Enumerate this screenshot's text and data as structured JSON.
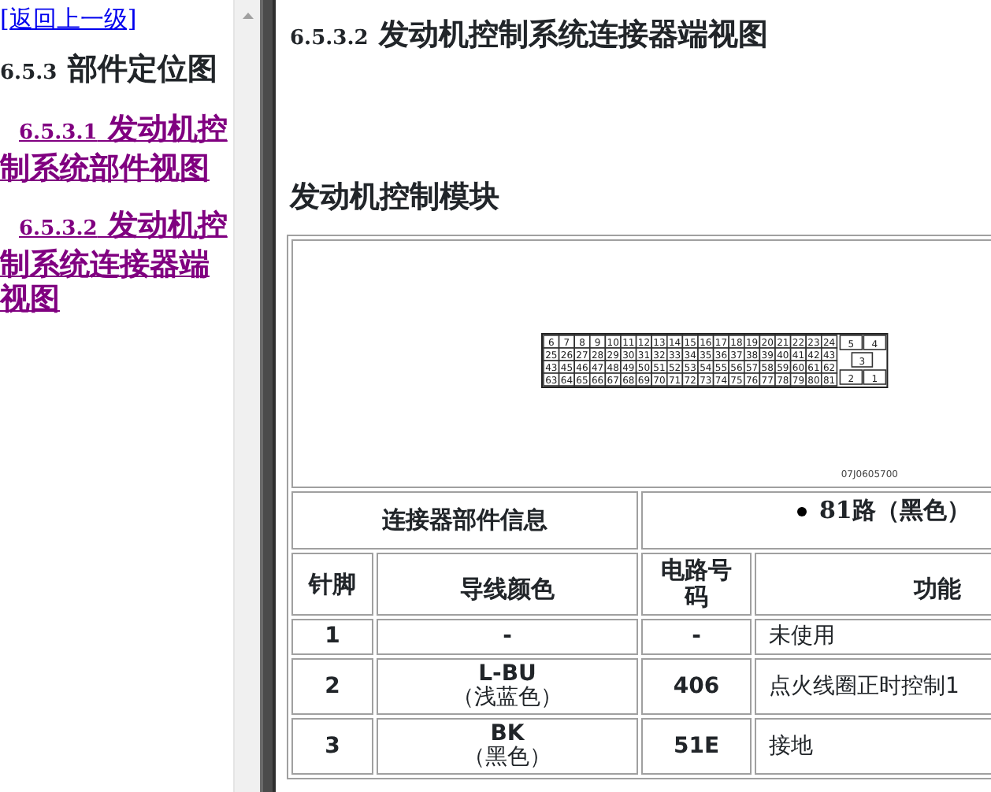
{
  "back_link": "[返回上一级]",
  "section_title": {
    "number": "6.5.3",
    "text": "部件定位图"
  },
  "nav_links": [
    {
      "number": "6.5.3.1",
      "text": "发动机控制系统部件视图"
    },
    {
      "number": "6.5.3.2",
      "text": "发动机控制系统连接器端视图"
    }
  ],
  "page_title": {
    "number": "6.5.3.2",
    "text": "发动机控制系统连接器端视图"
  },
  "subtitle": "发动机控制模块",
  "connector_diagram": {
    "pin_rows": [
      [
        "6",
        "7",
        "8",
        "9",
        "10",
        "11",
        "12",
        "13",
        "14",
        "15",
        "16",
        "17",
        "18",
        "19",
        "20",
        "21",
        "22",
        "23",
        "24"
      ],
      [
        "25",
        "26",
        "27",
        "28",
        "29",
        "30",
        "31",
        "32",
        "33",
        "34",
        "35",
        "36",
        "37",
        "38",
        "39",
        "40",
        "41",
        "42",
        "43"
      ],
      [
        "43",
        "45",
        "46",
        "47",
        "48",
        "49",
        "50",
        "51",
        "52",
        "53",
        "54",
        "55",
        "56",
        "57",
        "58",
        "59",
        "60",
        "61",
        "62"
      ],
      [
        "63",
        "64",
        "65",
        "66",
        "67",
        "68",
        "69",
        "70",
        "71",
        "72",
        "73",
        "74",
        "75",
        "76",
        "77",
        "78",
        "79",
        "80",
        "81"
      ]
    ],
    "side_pins": [
      "5",
      "4",
      "3",
      "2",
      "1"
    ],
    "code": "07J0605700"
  },
  "table": {
    "info_label": "连接器部件信息",
    "info_items": [
      "81路（黑色）"
    ],
    "columns": [
      "针脚",
      "导线颜色",
      "电路号码",
      "功能"
    ],
    "rows": [
      {
        "pin": "1",
        "wire_code": "-",
        "circuit": "-",
        "function": "未使用"
      },
      {
        "pin": "2",
        "wire_code": "L-BU",
        "wire_name": "（浅蓝色）",
        "circuit": "406",
        "function": "点火线圈正时控制1"
      },
      {
        "pin": "3",
        "wire_code": "BK",
        "wire_name": "（黑色）",
        "circuit": "51E",
        "function": "接地"
      }
    ]
  }
}
